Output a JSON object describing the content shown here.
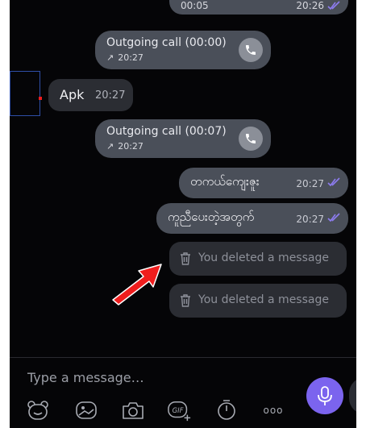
{
  "messages": {
    "top_partial": {
      "left_time": "00:05",
      "right_time": "20:26"
    },
    "call1": {
      "title": "Outgoing call (00:00)",
      "time": "20:27"
    },
    "incoming": {
      "text": "Apk",
      "time": "20:27"
    },
    "call2": {
      "title": "Outgoing call (00:07)",
      "time": "20:27"
    },
    "out1": {
      "text": "တကယ်ကျေးဇူး",
      "time": "20:27"
    },
    "out2": {
      "text": "ကူညီပေးတဲ့အတွက်",
      "time": "20:27"
    },
    "deleted1": {
      "text": "You deleted a message"
    },
    "deleted2": {
      "text": "You deleted a message"
    }
  },
  "composer": {
    "placeholder": "Type a message…"
  },
  "toolbar": {
    "icons": [
      "sticker-icon",
      "gallery-icon",
      "camera-icon",
      "gif-icon",
      "timer-icon",
      "more-icon",
      "microphone-icon"
    ],
    "gif_label": "GIF",
    "more_label": "ooo"
  },
  "colors": {
    "background": "#050507",
    "bubble": "#4a4f59",
    "deleted_bubble": "#2b2d33",
    "accent": "#7b64ee",
    "annotation_arrow": "#ef1d1d",
    "annotation_box": "#2f4fa8"
  }
}
